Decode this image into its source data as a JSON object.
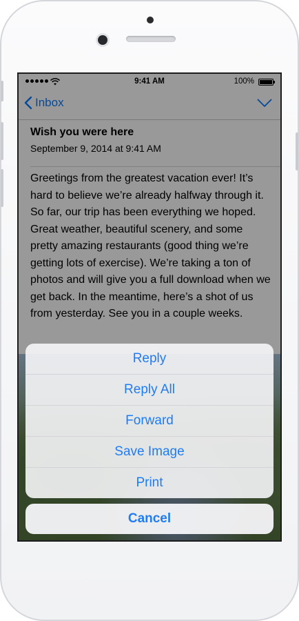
{
  "status_bar": {
    "time": "9:41 AM",
    "battery": "100%"
  },
  "nav": {
    "back_label": "Inbox"
  },
  "message": {
    "subject": "Wish you were here",
    "date": "September 9, 2014 at 9:41 AM",
    "body": "Greetings from the greatest vacation ever! It’s hard to believe we’re already halfway through it. So far, our trip has been everything we hoped. Great weather, beautiful scenery, and some pretty amazing restaurants (good thing we’re getting lots of exercise). We’re taking a ton of photos and will give you a full download when we get back. In the meantime, here’s a shot of us from yesterday. See you in a couple weeks."
  },
  "action_sheet": {
    "items": [
      {
        "label": "Reply"
      },
      {
        "label": "Reply All"
      },
      {
        "label": "Forward"
      },
      {
        "label": "Save Image"
      },
      {
        "label": "Print"
      }
    ],
    "cancel_label": "Cancel"
  },
  "colors": {
    "accent": "#1f7cf5",
    "dim_overlay": "rgba(0,0,0,0.40)"
  },
  "icons": [
    "signal-dots-icon",
    "wifi-icon",
    "battery-icon",
    "back-chevron-icon",
    "chevron-down-icon"
  ]
}
